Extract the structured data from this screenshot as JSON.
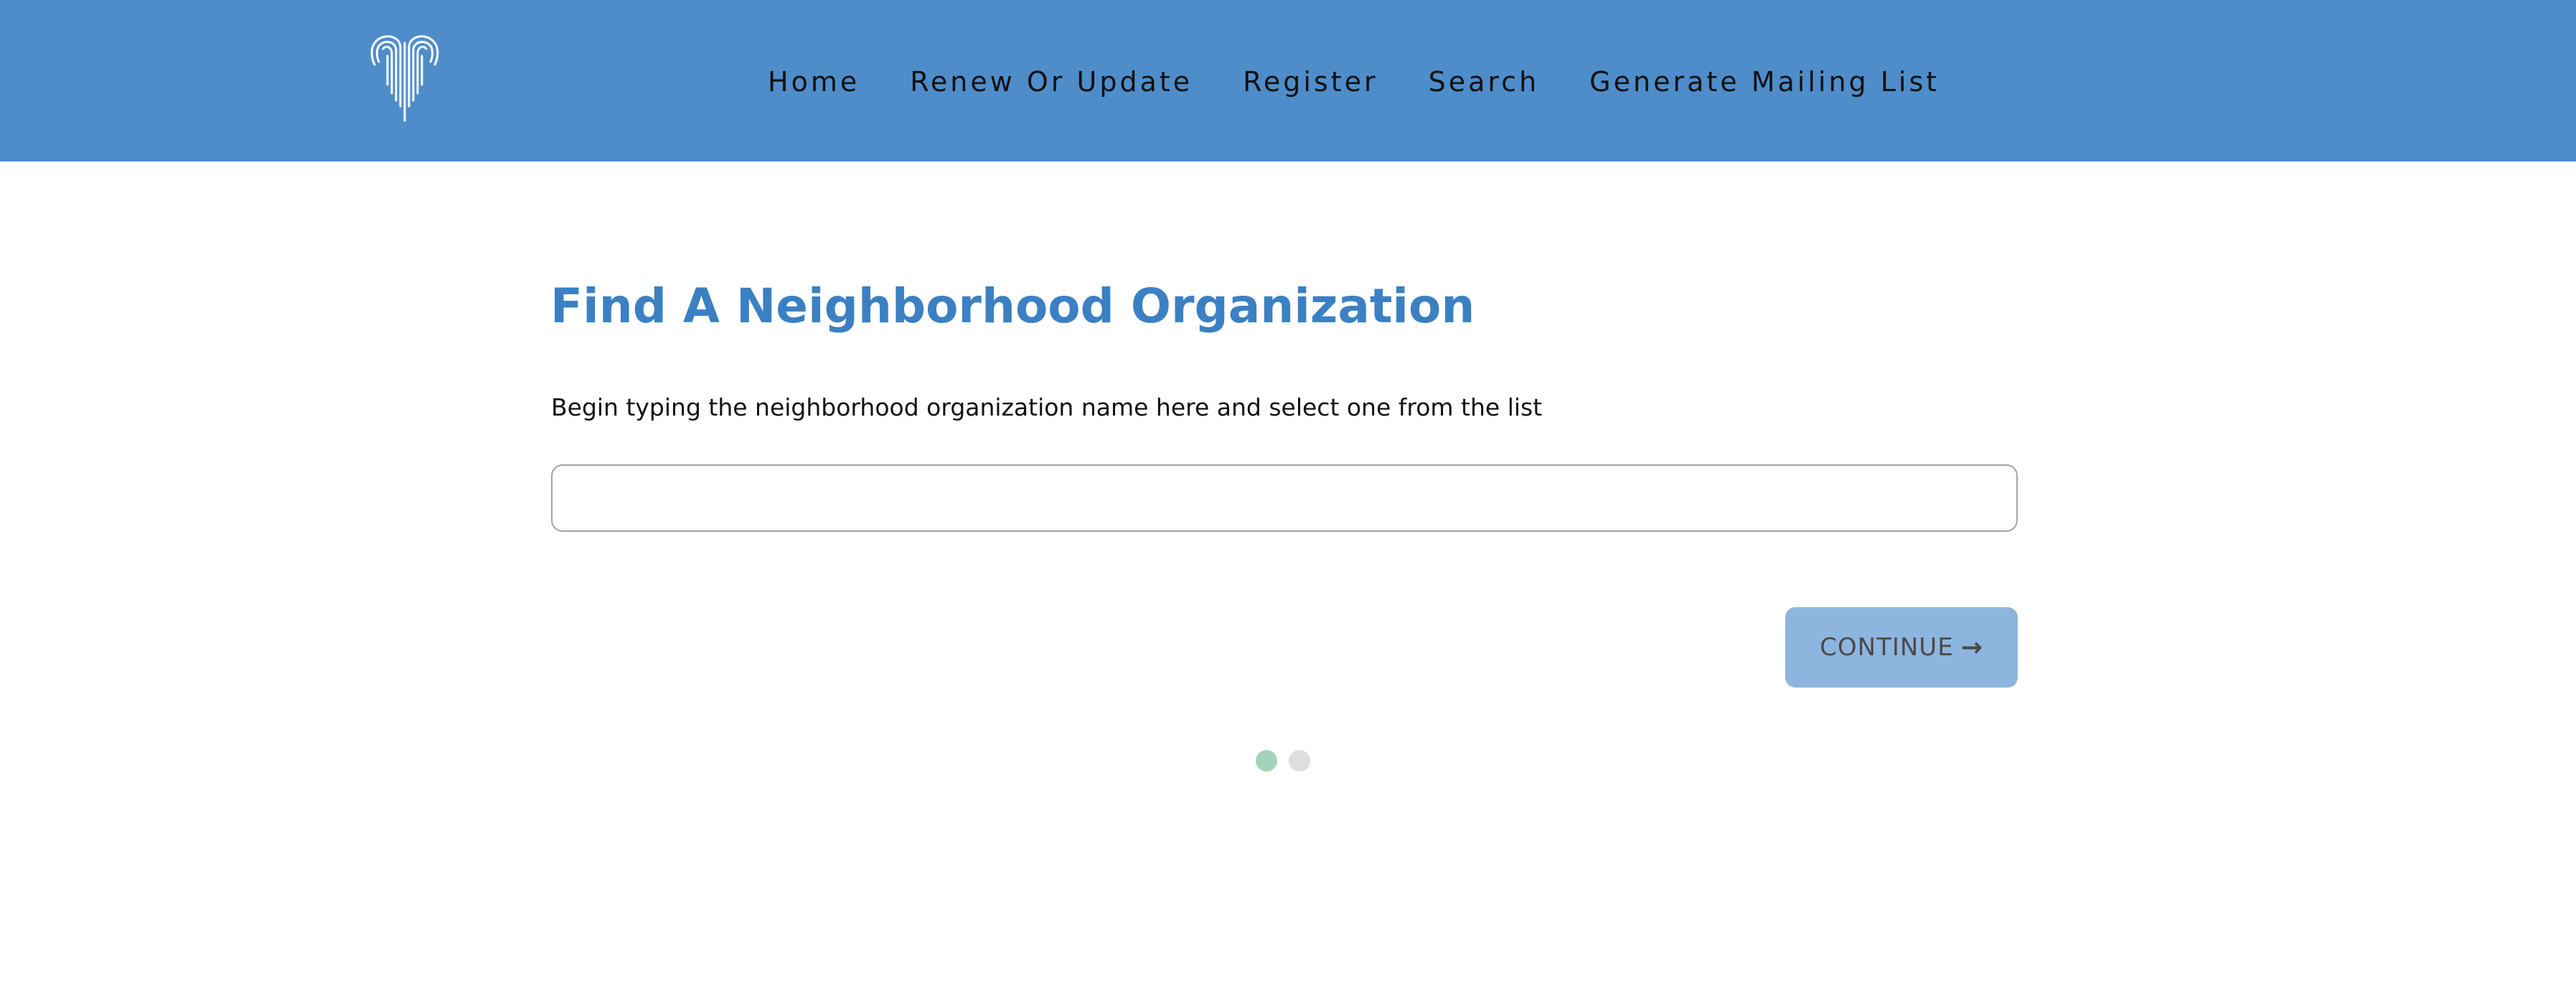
{
  "header": {
    "logo_icon": "fountain-logo-icon",
    "background_color": "#4e8dca",
    "nav": [
      {
        "label": "Home"
      },
      {
        "label": "Renew Or Update"
      },
      {
        "label": "Register"
      },
      {
        "label": "Search"
      },
      {
        "label": "Generate Mailing List"
      }
    ]
  },
  "main": {
    "title": "Find A Neighborhood Organization",
    "title_color": "#3b80c2",
    "instruction": "Begin typing the neighborhood organization name here and select one from the list",
    "search": {
      "value": "",
      "placeholder": ""
    },
    "continue_button": {
      "label": "CONTINUE",
      "icon": "arrow-right-icon",
      "color": "#8eb5de"
    },
    "steps": [
      {
        "state": "active",
        "color": "#a3d4b9"
      },
      {
        "state": "inactive",
        "color": "#dedede"
      }
    ]
  }
}
